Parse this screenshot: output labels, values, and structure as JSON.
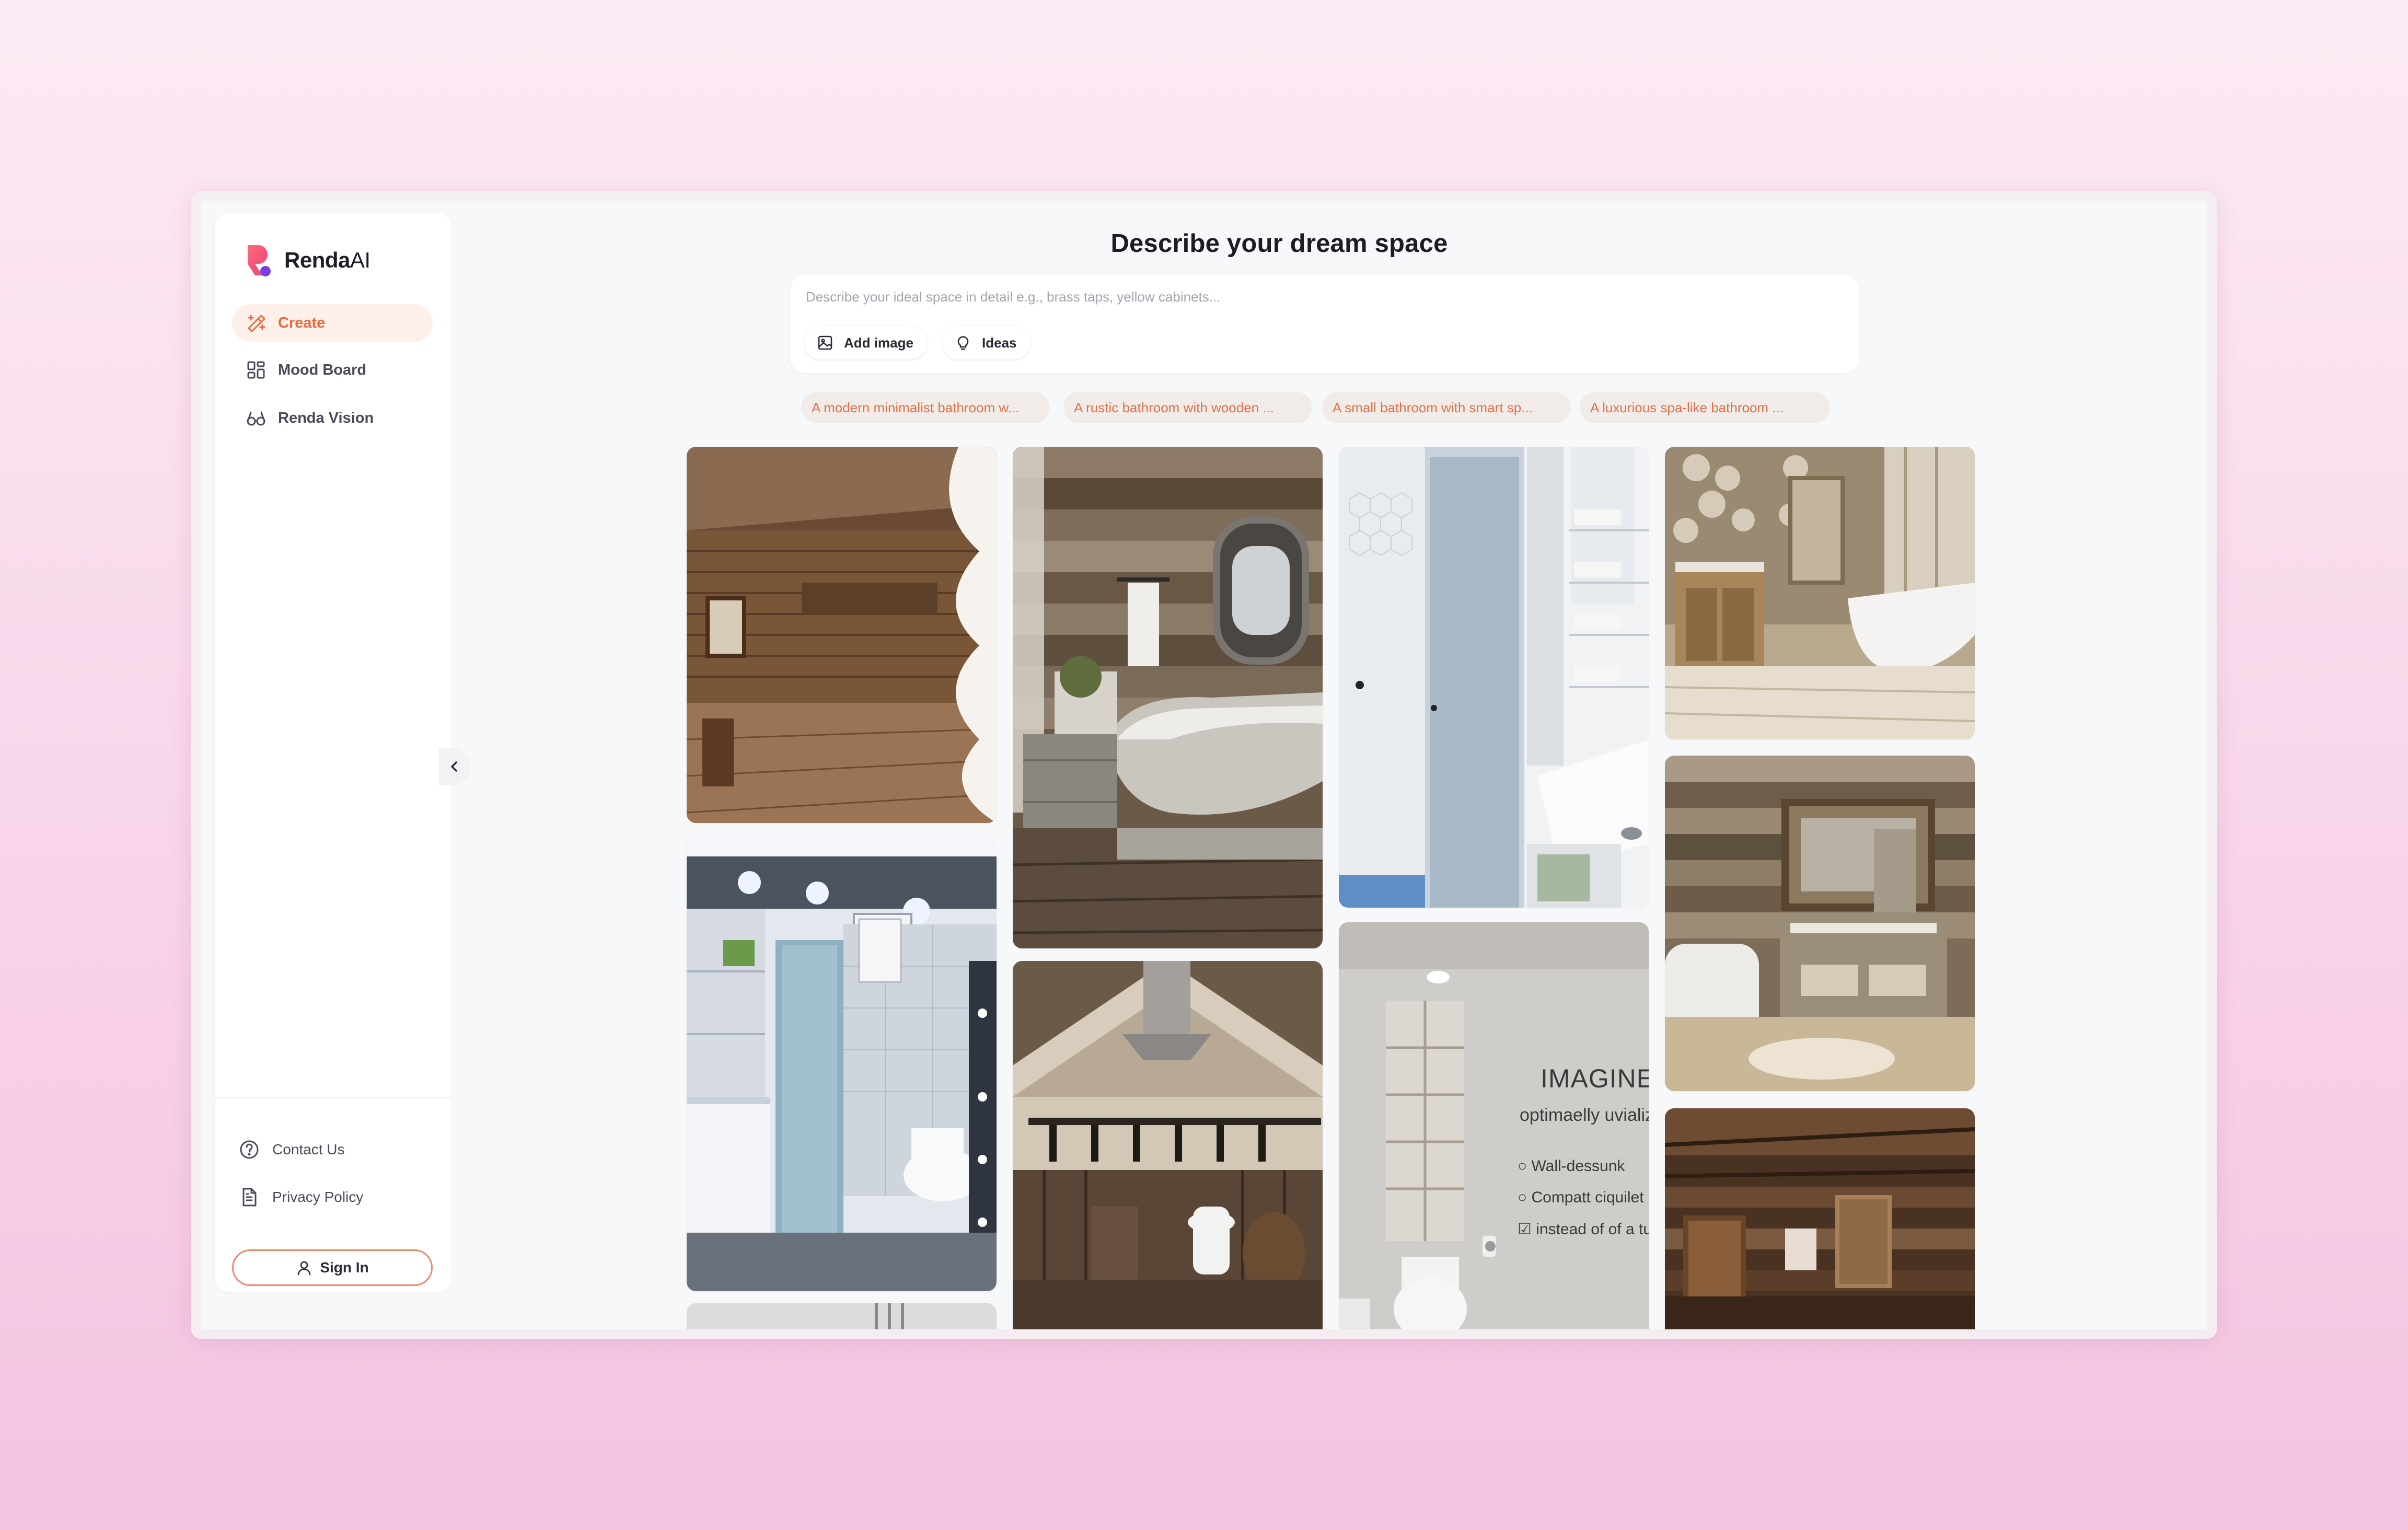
{
  "app": {
    "name_main": "Renda",
    "name_suffix": "AI"
  },
  "sidebar": {
    "items": [
      {
        "label": "Create",
        "icon": "create-icon",
        "active": true
      },
      {
        "label": "Mood Board",
        "icon": "grid-icon",
        "active": false
      },
      {
        "label": "Renda Vision",
        "icon": "glasses-icon",
        "active": false
      }
    ],
    "footer": [
      {
        "label": "Contact Us",
        "icon": "help-circle-icon"
      },
      {
        "label": "Privacy Policy",
        "icon": "document-icon"
      }
    ],
    "sign_in": "Sign In"
  },
  "main": {
    "title": "Describe your dream space",
    "prompt_placeholder": "Describe your ideal space in detail e.g., brass taps, yellow cabinets...",
    "buttons": {
      "add_image": "Add image",
      "ideas": "Ideas"
    },
    "suggestions": [
      "A modern minimalist bathroom w...",
      "A rustic bathroom with wooden ...",
      "A small bathroom with smart sp...",
      "A luxurious spa-like bathroom ..."
    ],
    "gallery_text": {
      "imagine": "IMAGINE",
      "line1": "optimaelly uvializ",
      "bullets": [
        "Wall-dessunk",
        "Compatt ciquilet",
        "instead of of a tub."
      ]
    }
  },
  "colors": {
    "accent": "#e96a3b",
    "accent_soft": "#fdf0eb",
    "chip_text": "#e2714a",
    "background_top": "#fcebf4",
    "background_bottom": "#f4c3e0"
  }
}
